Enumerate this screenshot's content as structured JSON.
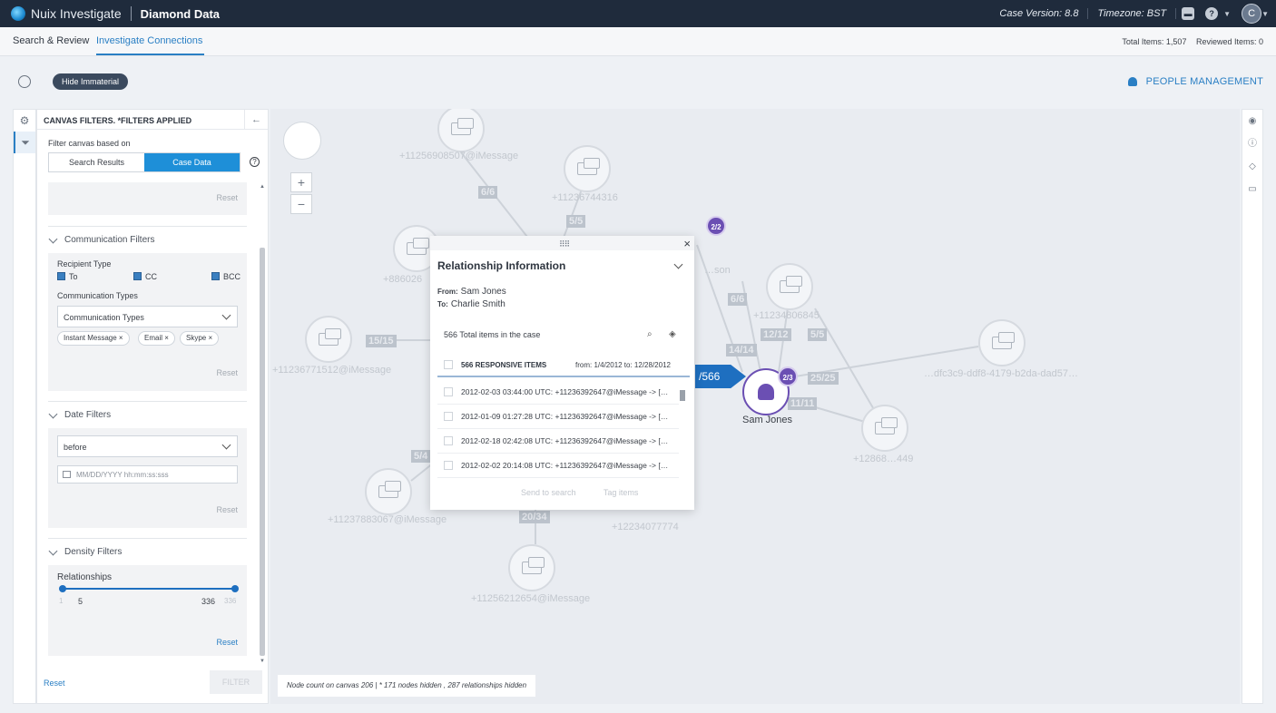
{
  "topbar": {
    "app_name": "Nuix Investigate",
    "project": "Diamond Data",
    "case_version": "Case Version: 8.8",
    "timezone": "Timezone: BST",
    "avatar": "C"
  },
  "nav": {
    "tabs": [
      "Search & Review",
      "Investigate Connections"
    ],
    "total_items": "Total Items: 1,507",
    "reviewed_items": "Reviewed Items: 0"
  },
  "toolbar": {
    "hide_immaterial": "Hide Immaterial",
    "people_management": "PEOPLE MANAGEMENT"
  },
  "panel": {
    "title": "CANVAS FILTERS. *FILTERS APPLIED",
    "filter_based": "Filter canvas based on",
    "seg_search": "Search Results",
    "seg_case": "Case Data",
    "reset": "Reset",
    "communication": {
      "title": "Communication Filters",
      "recipient_type": "Recipient Type",
      "to": "To",
      "cc": "CC",
      "bcc": "BCC",
      "comm_types": "Communication Types",
      "comm_placeholder": "Communication Types",
      "chips": [
        "Instant Message ×",
        "Email ×",
        "Skype ×"
      ]
    },
    "date": {
      "title": "Date Filters",
      "mode": "before",
      "placeholder": "MM/DD/YYYY hh:mm:ss:sss"
    },
    "density": {
      "title": "Density Filters",
      "relationships": "Relationships",
      "min_label": "1",
      "max_label": "336",
      "low": "5",
      "high": "336"
    },
    "footer_reset": "Reset",
    "filter_button": "FILTER"
  },
  "canvas": {
    "status": "Node count on canvas 206 | * 171 nodes hidden , 287 relationships hidden",
    "nodes": [
      "+11256908507@iMessage",
      "+11236744316",
      "+886026",
      "+11234806845",
      "+11236771512@iMessage",
      "…dfc3c9-ddf8-4179-b2da-dad57…",
      "+12868…449",
      "+11237883067@iMessage",
      "+12234077774",
      "+11256212654@iMessage",
      "…son"
    ],
    "edges": [
      "6/6",
      "5/5",
      "6/6",
      "15/15",
      "12/12",
      "5/5",
      "14/14",
      "25/25",
      "11/11",
      "5/4",
      "20/34"
    ],
    "arrow_label": "/566",
    "sam_badge": "2/3",
    "top_badge": "2/2",
    "sam_label": "Sam Jones"
  },
  "modal": {
    "title": "Relationship Information",
    "from_label": "From:",
    "from": "Sam Jones",
    "to_label": "To:",
    "to": "Charlie Smith",
    "total": "566 Total items in the case",
    "responsive": "566 RESPONSIVE ITEMS",
    "range": "from: 1/4/2012  to: 12/28/2012",
    "rows": [
      "2012-02-03 03:44:00 UTC: +11236392647@iMessage -> […",
      "2012-01-09 01:27:28 UTC: +11236392647@iMessage -> […",
      "2012-02-18 02:42:08 UTC: +11236392647@iMessage -> […",
      "2012-02-02 20:14:08 UTC: +11236392647@iMessage -> […"
    ],
    "send_to_search": "Send to search",
    "tag_items": "Tag items"
  }
}
